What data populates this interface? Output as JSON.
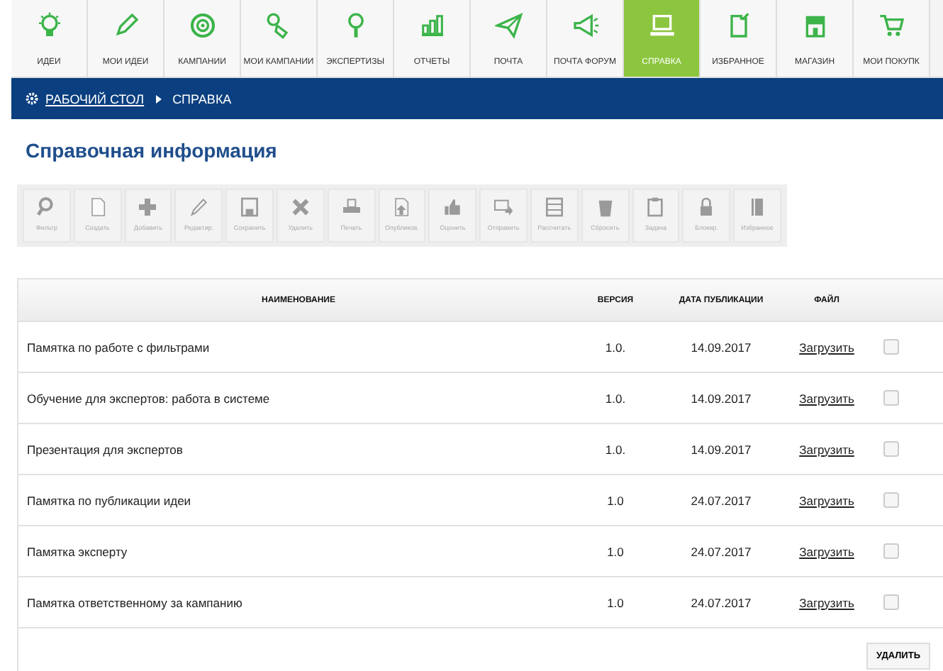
{
  "nav": [
    {
      "label": "ИДЕИ",
      "selected": false
    },
    {
      "label": "МОИ ИДЕИ",
      "selected": false
    },
    {
      "label": "КАМПАНИИ",
      "selected": false
    },
    {
      "label": "МОИ КАМПАНИИ",
      "selected": false
    },
    {
      "label": "ЭКСПЕРТИЗЫ",
      "selected": false
    },
    {
      "label": "ОТЧЕТЫ",
      "selected": false
    },
    {
      "label": "ПОЧТА",
      "selected": false
    },
    {
      "label": "ПОЧТА ФОРУМ",
      "selected": false
    },
    {
      "label": "СПРАВКА",
      "selected": true
    },
    {
      "label": "ИЗБРАННОЕ",
      "selected": false
    },
    {
      "label": "МАГАЗИН",
      "selected": false
    },
    {
      "label": "МОИ ПОКУПК",
      "selected": false
    }
  ],
  "breadcrumb": {
    "link": "РАБОЧИЙ СТОЛ",
    "current": "СПРАВКА"
  },
  "title": "Справочная информация",
  "toolbar": [
    {
      "label": "Фильтр",
      "disabled": true
    },
    {
      "label": "Создать",
      "disabled": true
    },
    {
      "label": "Добавить",
      "disabled": true
    },
    {
      "label": "Редактир.",
      "disabled": true
    },
    {
      "label": "Сохранить",
      "disabled": true
    },
    {
      "label": "Удалить",
      "disabled": true
    },
    {
      "label": "Печать",
      "disabled": true
    },
    {
      "label": "Опубликов.",
      "disabled": true
    },
    {
      "label": "Оценить",
      "disabled": true
    },
    {
      "label": "Отправить",
      "disabled": true
    },
    {
      "label": "Рассчитать",
      "disabled": true
    },
    {
      "label": "Сбросить",
      "disabled": true
    },
    {
      "label": "Задача",
      "disabled": true
    },
    {
      "label": "Блокир.",
      "disabled": true
    },
    {
      "label": "Избранное",
      "disabled": true
    }
  ],
  "table": {
    "columns": [
      "НАИМЕНОВАНИЕ",
      "ВЕРСИЯ",
      "ДАТА ПУБЛИКАЦИИ",
      "ФАЙЛ"
    ],
    "rows": [
      {
        "name": "Памятка по работе с фильтрами",
        "version": "1.0.",
        "date": "14.09.2017",
        "file": "Загрузить",
        "checked": false
      },
      {
        "name": "Обучение для экспертов: работа в системе",
        "version": "1.0.",
        "date": "14.09.2017",
        "file": "Загрузить",
        "checked": false
      },
      {
        "name": "Презентация для экспертов",
        "version": "1.0.",
        "date": "14.09.2017",
        "file": "Загрузить",
        "checked": false
      },
      {
        "name": "Памятка по публикации идеи",
        "version": "1.0",
        "date": "24.07.2017",
        "file": "Загрузить",
        "checked": false
      },
      {
        "name": "Памятка эксперту",
        "version": "1.0",
        "date": "24.07.2017",
        "file": "Загрузить",
        "checked": false
      },
      {
        "name": "Памятка ответственному за кампанию",
        "version": "1.0",
        "date": "24.07.2017",
        "file": "Загрузить",
        "checked": false
      }
    ]
  },
  "delete_button": "УДАЛИТЬ"
}
